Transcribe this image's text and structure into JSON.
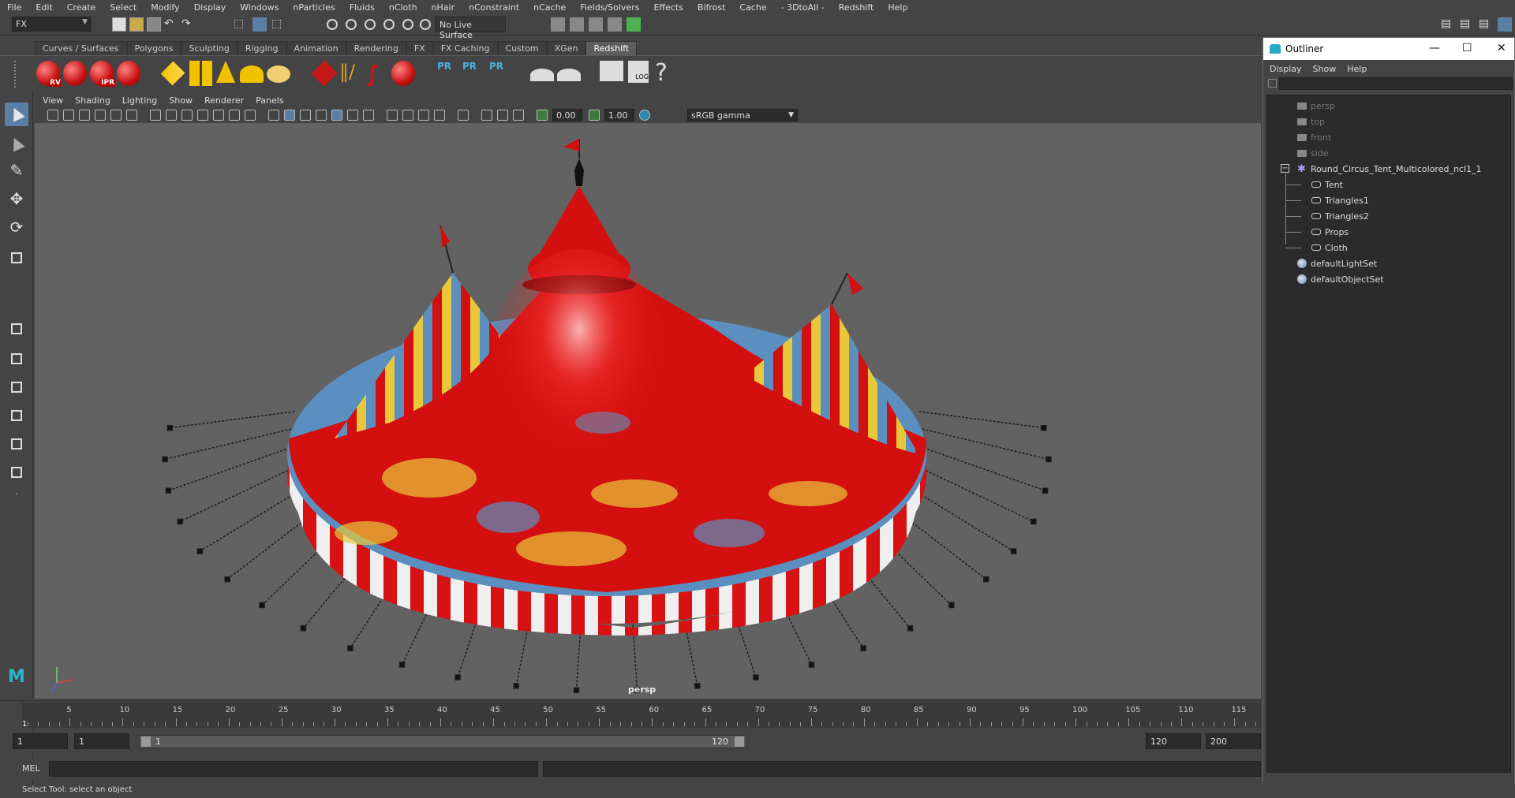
{
  "menubar": [
    "File",
    "Edit",
    "Create",
    "Select",
    "Modify",
    "Display",
    "Windows",
    "nParticles",
    "Fluids",
    "nCloth",
    "nHair",
    "nConstraint",
    "nCache",
    "Fields/Solvers",
    "Effects",
    "Bifrost",
    "Cache",
    "- 3DtoAll -",
    "Redshift",
    "Help"
  ],
  "status": {
    "mode": "FX",
    "live_surface": "No Live Surface"
  },
  "shelf_tabs": [
    "Curves / Surfaces",
    "Polygons",
    "Sculpting",
    "Rigging",
    "Animation",
    "Rendering",
    "FX",
    "FX Caching",
    "Custom",
    "XGen",
    "Redshift"
  ],
  "shelf_active": "Redshift",
  "shelf_labels": {
    "rv": "RV",
    "ipr": "IPR",
    "pr": "PR",
    "log": "LOG",
    "help": "?"
  },
  "viewport_menu": [
    "View",
    "Shading",
    "Lighting",
    "Show",
    "Renderer",
    "Panels"
  ],
  "viewport_fields": {
    "exposure": "0.00",
    "gamma": "1.00",
    "colorspace": "sRGB gamma"
  },
  "camera_label": "persp",
  "outliner": {
    "title": "Outliner",
    "window_buttons": {
      "minimize": "—",
      "maximize": "☐",
      "close": "✕"
    },
    "menu": [
      "Display",
      "Show",
      "Help"
    ],
    "cameras": [
      "persp",
      "top",
      "front",
      "side"
    ],
    "root": "Round_Circus_Tent_Multicolored_ncl1_1",
    "children": [
      "Tent",
      "Triangles1",
      "Triangles2",
      "Props",
      "Cloth"
    ],
    "sets": [
      "defaultLightSet",
      "defaultObjectSet"
    ],
    "expander": "−"
  },
  "timeline": {
    "ticks": [
      "5",
      "10",
      "15",
      "20",
      "25",
      "30",
      "35",
      "40",
      "45",
      "50",
      "55",
      "60",
      "65",
      "70",
      "75",
      "80",
      "85",
      "90",
      "95",
      "100",
      "105",
      "110",
      "115"
    ],
    "current": "1"
  },
  "range": {
    "start": "1",
    "start2": "1",
    "inner_start": "1",
    "inner_end": "120",
    "end": "120",
    "end2": "200"
  },
  "cmd_label": "MEL",
  "help_line": "Select Tool: select an object",
  "colors": {
    "tent_red": "#d40f0f",
    "tent_yellow": "#e8c83a",
    "tent_blue": "#5a8fc0",
    "viewport_bg": "#626262",
    "ui_bg": "#444444"
  }
}
